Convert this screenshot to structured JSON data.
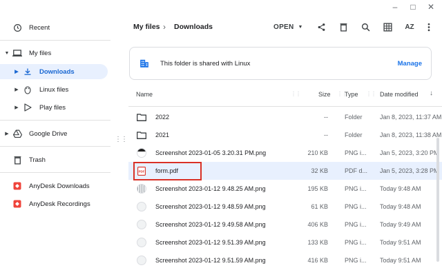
{
  "window_controls": {
    "minimize": "–",
    "maximize": "□",
    "close": "✕"
  },
  "sidebar": {
    "items": [
      {
        "label": "Recent",
        "icon": "clock-icon"
      },
      {
        "label": "My files",
        "icon": "laptop-icon",
        "expanded": true
      },
      {
        "label": "Downloads",
        "icon": "download-icon",
        "active": true
      },
      {
        "label": "Linux files",
        "icon": "penguin-icon"
      },
      {
        "label": "Play files",
        "icon": "play-icon"
      },
      {
        "label": "Google Drive",
        "icon": "drive-icon"
      },
      {
        "label": "Trash",
        "icon": "trash-icon"
      },
      {
        "label": "AnyDesk Downloads",
        "icon": "anydesk-icon"
      },
      {
        "label": "AnyDesk Recordings",
        "icon": "anydesk-icon"
      }
    ]
  },
  "header": {
    "breadcrumb": [
      "My files",
      "Downloads"
    ],
    "open_label": "OPEN",
    "tools": [
      "share-icon",
      "delete-icon",
      "search-icon",
      "grid-view-icon",
      "sort-icon",
      "more-vert-icon"
    ],
    "sort_label": "AZ"
  },
  "banner": {
    "text": "This folder is shared with Linux",
    "action": "Manage"
  },
  "table": {
    "columns": {
      "name": "Name",
      "size": "Size",
      "type": "Type",
      "date": "Date modified"
    },
    "rows": [
      {
        "name": "2022",
        "size": "--",
        "type": "Folder",
        "date": "Jan 8, 2023, 11:37 AM",
        "icon": "folder-icon"
      },
      {
        "name": "2021",
        "size": "--",
        "type": "Folder",
        "date": "Jan 8, 2023, 11:38 AM",
        "icon": "folder-icon"
      },
      {
        "name": "Screenshot 2023-01-05 3.20.31 PM.png",
        "size": "210 KB",
        "type": "PNG i...",
        "date": "Jan 5, 2023, 3:20 PM",
        "icon": "image-thumbnail"
      },
      {
        "name": "form.pdf",
        "size": "32 KB",
        "type": "PDF d...",
        "date": "Jan 5, 2023, 3:28 PM",
        "icon": "pdf-icon",
        "selected": true
      },
      {
        "name": "Screenshot 2023-01-12 9.48.25 AM.png",
        "size": "195 KB",
        "type": "PNG i...",
        "date": "Today 9:48 AM",
        "icon": "image-thumbnail"
      },
      {
        "name": "Screenshot 2023-01-12 9.48.59 AM.png",
        "size": "61 KB",
        "type": "PNG i...",
        "date": "Today 9:48 AM",
        "icon": "image-thumbnail"
      },
      {
        "name": "Screenshot 2023-01-12 9.49.58 AM.png",
        "size": "406 KB",
        "type": "PNG i...",
        "date": "Today 9:49 AM",
        "icon": "image-thumbnail"
      },
      {
        "name": "Screenshot 2023-01-12 9.51.39 AM.png",
        "size": "133 KB",
        "type": "PNG i...",
        "date": "Today 9:51 AM",
        "icon": "image-thumbnail"
      },
      {
        "name": "Screenshot 2023-01-12 9.51.59 AM.png",
        "size": "416 KB",
        "type": "PNG i...",
        "date": "Today 9:51 AM",
        "icon": "image-thumbnail"
      }
    ]
  },
  "colors": {
    "accent": "#1a73e8",
    "selection": "#e8f0fe",
    "highlight_box": "#d93025",
    "pdf": "#d93025",
    "anydesk": "#ef443b"
  }
}
